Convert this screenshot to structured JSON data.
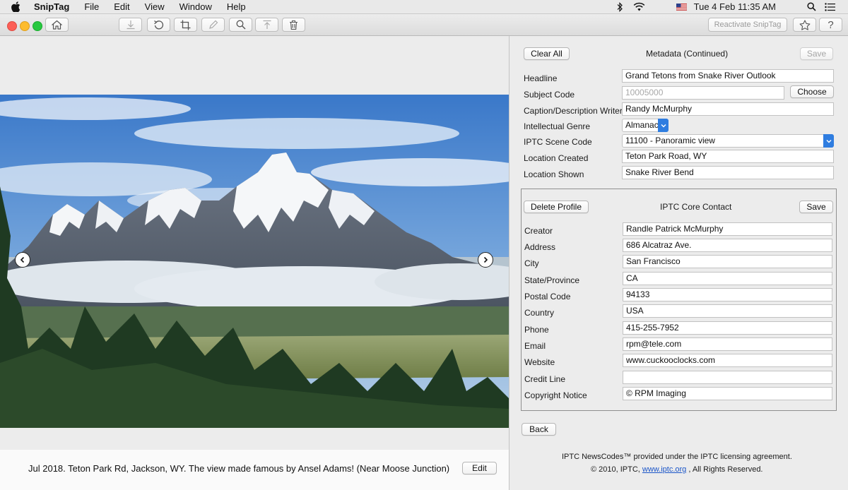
{
  "menubar": {
    "app_name": "SnipTag",
    "menus": [
      "File",
      "Edit",
      "View",
      "Window",
      "Help"
    ],
    "date_time": "Tue 4 Feb  11:35 AM"
  },
  "toolbar": {
    "reactivate_label": "Reactivate SnipTag",
    "traffic_lights": {
      "close": "#fc5f57",
      "minimize": "#fdbc2e",
      "zoom": "#28c840"
    }
  },
  "viewer": {
    "caption": "Jul 2018. Teton Park Rd, Jackson, WY. The view made famous by Ansel Adams! (Near Moose Junction)",
    "edit_label": "Edit"
  },
  "metadata": {
    "clear_all_label": "Clear All",
    "title": "Metadata (Continued)",
    "save_label": "Save",
    "choose_label": "Choose",
    "fields": {
      "headline_label": "Headline",
      "headline_value": "Grand Tetons from Snake River Outlook",
      "subject_code_label": "Subject Code",
      "subject_code_placeholder": "10005000",
      "writer_label": "Caption/Description Writer",
      "writer_value": "Randy McMurphy",
      "genre_label": "Intellectual Genre",
      "genre_value": "Almanac",
      "scene_label": "IPTC Scene Code",
      "scene_value": "11100 - Panoramic view",
      "loc_created_label": "Location Created",
      "loc_created_value": "Teton Park Road, WY",
      "loc_shown_label": "Location Shown",
      "loc_shown_value": "Snake River Bend"
    }
  },
  "contact": {
    "delete_label": "Delete Profile",
    "title": "IPTC Core Contact",
    "save_label": "Save",
    "fields": [
      {
        "label": "Creator",
        "value": "Randle Patrick McMurphy"
      },
      {
        "label": "Address",
        "value": "686 Alcatraz Ave."
      },
      {
        "label": "City",
        "value": "San Francisco"
      },
      {
        "label": "State/Province",
        "value": "CA"
      },
      {
        "label": "Postal Code",
        "value": "94133"
      },
      {
        "label": "Country",
        "value": "USA"
      },
      {
        "label": "Phone",
        "value": "415-255-7952"
      },
      {
        "label": "Email",
        "value": "rpm@tele.com"
      },
      {
        "label": "Website",
        "value": "www.cuckooclocks.com"
      },
      {
        "label": "Credit Line",
        "value": ""
      },
      {
        "label": "Copyright Notice",
        "value": "© RPM Imaging"
      }
    ]
  },
  "footer": {
    "back_label": "Back",
    "line1": "IPTC NewsCodes™ provided under the IPTC licensing agreement.",
    "line2_pre": "© 2010, IPTC, ",
    "line2_link": "www.iptc.org",
    "line2_post": " , All Rights Reserved."
  }
}
